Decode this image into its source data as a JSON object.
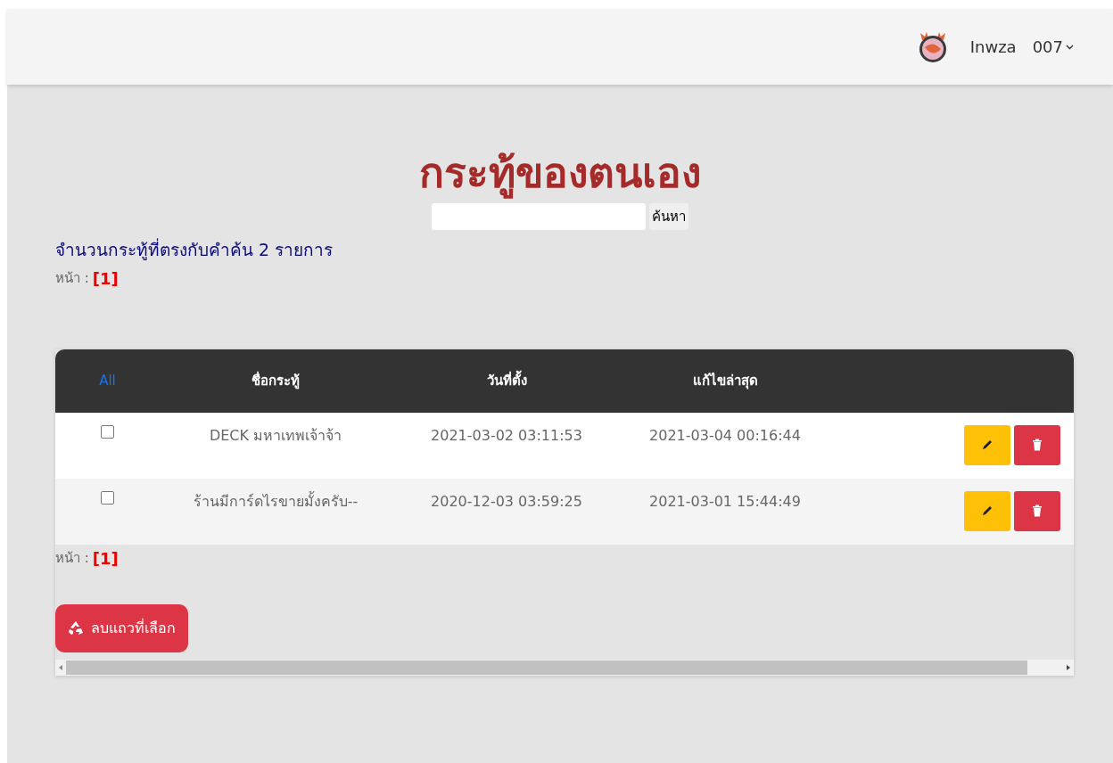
{
  "navbar": {
    "user_name": "Inwza",
    "user_menu": "007"
  },
  "title": "กระทู้ของตนเอง",
  "search": {
    "button": "ค้นหา"
  },
  "result_count": "จำนวนกระทู้ที่ตรงกับคำค้น 2 รายการ",
  "pager_top": {
    "label": "หน้า :",
    "pages": [
      {
        "text": "[1]",
        "selected": true
      }
    ]
  },
  "table": {
    "columns": [
      "All",
      "ชื่อกระทู้",
      "วันที่ตั้ง",
      "แก้ไขล่าสุด"
    ],
    "rows": [
      {
        "checked": false,
        "title": "DECK มหาเทพเจ้าจ้า",
        "created": "2021-03-02 03:11:53",
        "edited": "2021-03-04 00:16:44"
      },
      {
        "checked": false,
        "title": "ร้านมีการ์ดไรขายมั้งครับ--",
        "created": "2020-12-03 03:59:25",
        "edited": "2021-03-01 15:44:49"
      }
    ]
  },
  "pager_bottom": {
    "label": "หน้า :",
    "pages": [
      {
        "text": "[1]",
        "selected": true
      }
    ]
  },
  "delete_selected_button": "ลบแถวที่เลือก"
}
